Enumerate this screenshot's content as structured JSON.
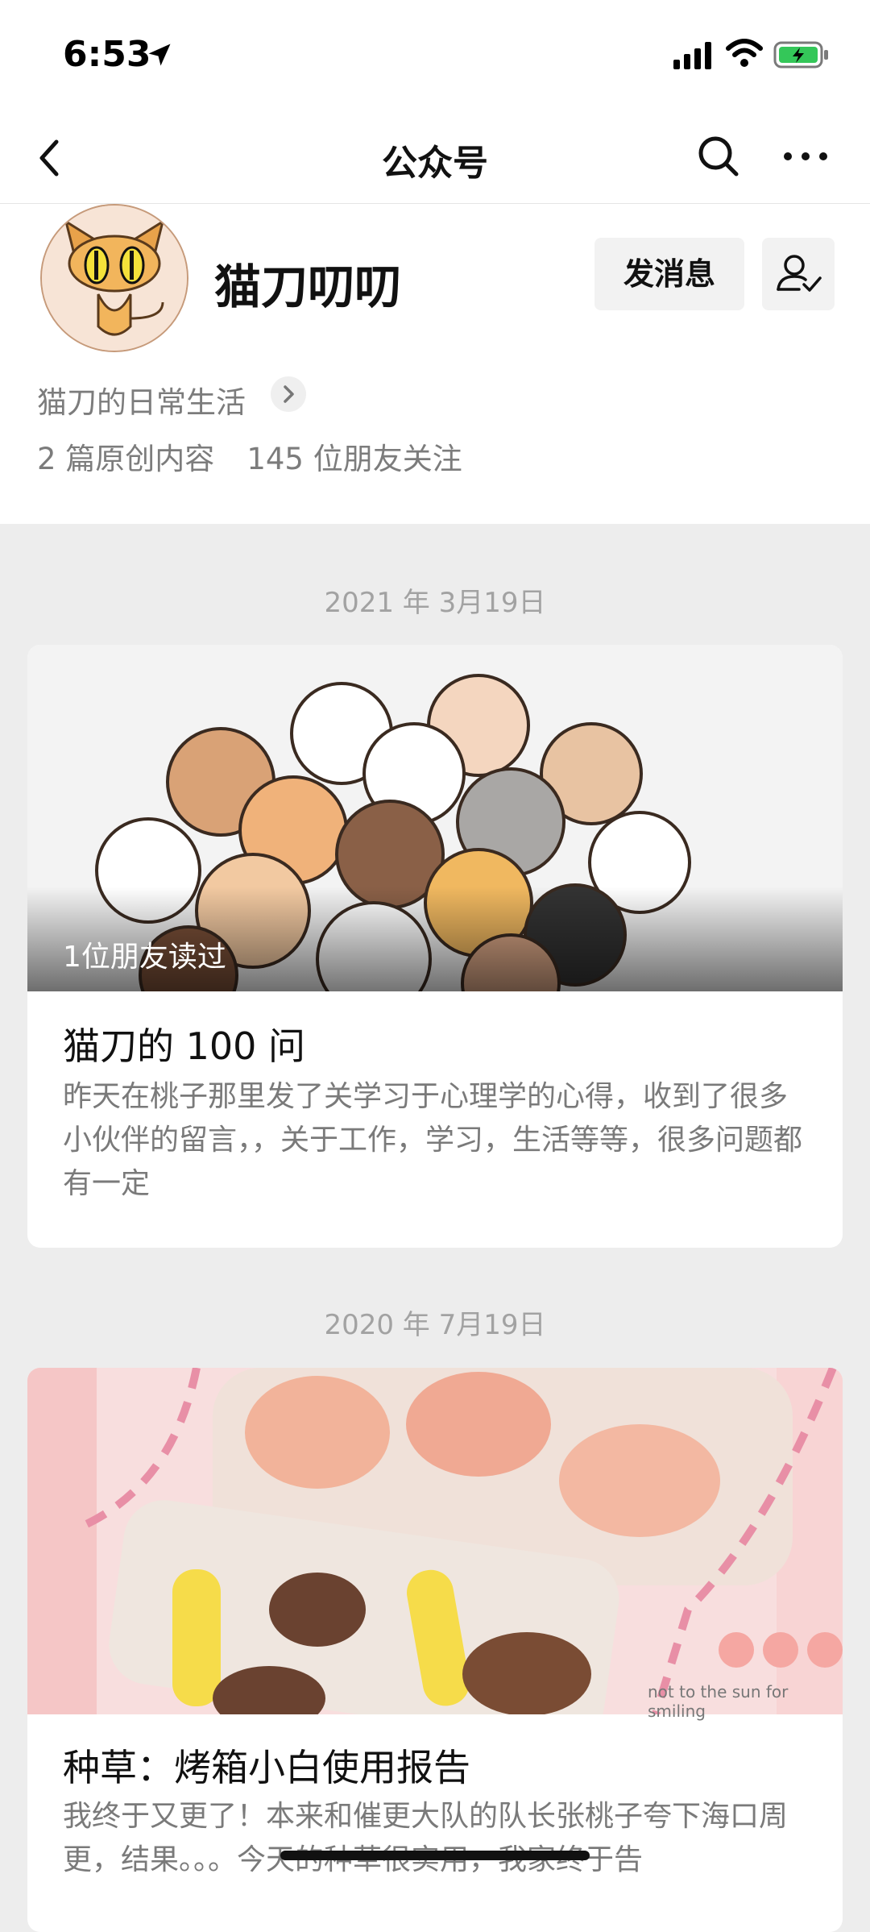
{
  "status_bar": {
    "time": "6:53"
  },
  "nav": {
    "title": "公众号"
  },
  "profile": {
    "name": "猫刀叨叨",
    "message_button": "发消息",
    "bio": "猫刀的日常生活",
    "stats": {
      "original": "2 篇原创内容",
      "followers": "145 位朋友关注"
    }
  },
  "feed": [
    {
      "date": "2021 年 3月19日",
      "read_badge": "1位朋友读过",
      "title": "猫刀的 100 问",
      "summary": "昨天在桃子那里发了关学习于心理学的心得，收到了很多小伙伴的留言，，关于工作，学习，生活等等，很多问题都有一定"
    },
    {
      "date": "2020 年 7月19日",
      "cover_caption": "not to the sun for smiling",
      "title": "种草：烤箱小白使用报告",
      "summary": "我终于又更了！本来和催更大队的队长张桃子夸下海口周更，结果。。。今天的种草很实用，我家终于告"
    }
  ]
}
